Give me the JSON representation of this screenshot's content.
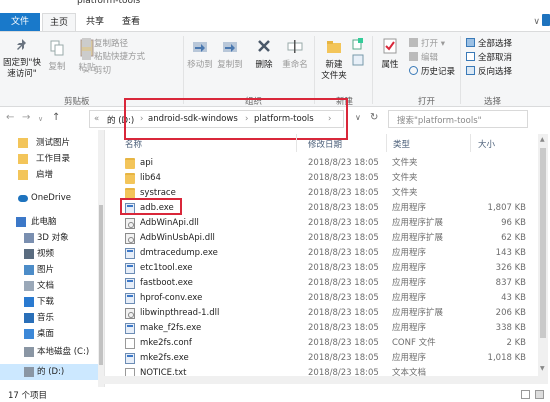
{
  "window": {
    "title": "platform-tools"
  },
  "tabs": [
    "文件",
    "主页",
    "共享",
    "查看"
  ],
  "ribbon": {
    "pin_label": "固定到\"快\n速访问\"",
    "copy_label": "复制",
    "paste_label": "粘贴",
    "cut_label": "剪切",
    "copy_path_label": "复制路径",
    "paste_shortcut_label": "粘贴快捷方式",
    "group_clipboard": "剪贴板",
    "move_to_label": "移动到",
    "copy_to_label": "复制到",
    "delete_label": "删除",
    "rename_label": "重命名",
    "group_organize": "组织",
    "new_folder_label": "新建\n文件夹",
    "group_new": "新建",
    "properties_label": "属性",
    "open_label": "打开 ▾",
    "edit_label": "编辑",
    "history_label": "历史记录",
    "group_open": "打开",
    "select_all_label": "全部选择",
    "select_none_label": "全部取消",
    "invert_label": "反向选择",
    "group_select": "选择"
  },
  "address": {
    "crumbs": [
      "«",
      "的 (D:)",
      "›",
      "android-sdk-windows",
      "›",
      "platform-tools",
      "›"
    ],
    "search_placeholder": "搜索\"platform-tools\""
  },
  "nav": {
    "items": [
      {
        "label": "测试图片",
        "icon": "folder-icon"
      },
      {
        "label": "工作目录",
        "icon": "folder-icon"
      },
      {
        "label": "启增",
        "icon": "folder-icon"
      },
      {
        "label": "OneDrive",
        "icon": "cloud-icon"
      },
      {
        "label": "此电脑",
        "icon": "computer-icon"
      },
      {
        "label": "3D 对象",
        "icon": "cube-icon"
      },
      {
        "label": "视频",
        "icon": "video-icon"
      },
      {
        "label": "图片",
        "icon": "picture-icon"
      },
      {
        "label": "文档",
        "icon": "document-icon"
      },
      {
        "label": "下载",
        "icon": "download-icon"
      },
      {
        "label": "音乐",
        "icon": "music-icon"
      },
      {
        "label": "桌面",
        "icon": "desktop-icon"
      },
      {
        "label": "本地磁盘 (C:)",
        "icon": "drive-icon"
      },
      {
        "label": "的 (D:)",
        "icon": "drive-icon"
      }
    ]
  },
  "columns": {
    "name": "名称",
    "date": "修改日期",
    "type": "类型",
    "size": "大小"
  },
  "files": [
    {
      "name": "api",
      "date": "2018/8/23 18:05",
      "type": "文件夹",
      "size": "",
      "icon": "folder"
    },
    {
      "name": "lib64",
      "date": "2018/8/23 18:05",
      "type": "文件夹",
      "size": "",
      "icon": "folder"
    },
    {
      "name": "systrace",
      "date": "2018/8/23 18:05",
      "type": "文件夹",
      "size": "",
      "icon": "folder"
    },
    {
      "name": "adb.exe",
      "date": "2018/8/23 18:05",
      "type": "应用程序",
      "size": "1,807 KB",
      "icon": "exe"
    },
    {
      "name": "AdbWinApi.dll",
      "date": "2018/8/23 18:05",
      "type": "应用程序扩展",
      "size": "96 KB",
      "icon": "dll"
    },
    {
      "name": "AdbWinUsbApi.dll",
      "date": "2018/8/23 18:05",
      "type": "应用程序扩展",
      "size": "62 KB",
      "icon": "dll"
    },
    {
      "name": "dmtracedump.exe",
      "date": "2018/8/23 18:05",
      "type": "应用程序",
      "size": "143 KB",
      "icon": "exe"
    },
    {
      "name": "etc1tool.exe",
      "date": "2018/8/23 18:05",
      "type": "应用程序",
      "size": "326 KB",
      "icon": "exe"
    },
    {
      "name": "fastboot.exe",
      "date": "2018/8/23 18:05",
      "type": "应用程序",
      "size": "837 KB",
      "icon": "exe"
    },
    {
      "name": "hprof-conv.exe",
      "date": "2018/8/23 18:05",
      "type": "应用程序",
      "size": "43 KB",
      "icon": "exe"
    },
    {
      "name": "libwinpthread-1.dll",
      "date": "2018/8/23 18:05",
      "type": "应用程序扩展",
      "size": "206 KB",
      "icon": "dll"
    },
    {
      "name": "make_f2fs.exe",
      "date": "2018/8/23 18:05",
      "type": "应用程序",
      "size": "338 KB",
      "icon": "exe"
    },
    {
      "name": "mke2fs.conf",
      "date": "2018/8/23 18:05",
      "type": "CONF 文件",
      "size": "2 KB",
      "icon": "doc"
    },
    {
      "name": "mke2fs.exe",
      "date": "2018/8/23 18:05",
      "type": "应用程序",
      "size": "1,018 KB",
      "icon": "exe"
    },
    {
      "name": "NOTICE.txt",
      "date": "2018/8/23 18:05",
      "type": "文本文档",
      "size": "",
      "icon": "doc"
    }
  ],
  "status": {
    "item_count": "17 个项目"
  },
  "colors": {
    "file_tab": "#1979ca",
    "highlight_box": "#d9273a",
    "selected": "#cce8ff"
  }
}
